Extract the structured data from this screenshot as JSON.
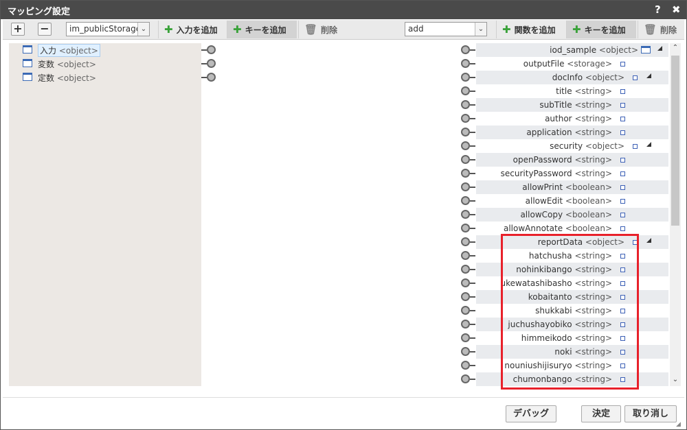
{
  "window": {
    "title": "マッピング設定",
    "help_icon": "?",
    "close_icon": "✖"
  },
  "toolbar": {
    "expand_label": "+",
    "collapse_label": "−",
    "left_select_value": "im_publicStorage",
    "left_add_input": "入力を追加",
    "left_add_key": "キーを追加",
    "left_delete": "削除",
    "right_select_value": "add",
    "right_add_function": "関数を追加",
    "right_add_key": "キーを追加",
    "right_delete": "削除"
  },
  "left_nodes": [
    {
      "name": "入力",
      "type": "<object>"
    },
    {
      "name": "変数",
      "type": "<object>"
    },
    {
      "name": "定数",
      "type": "<object>"
    }
  ],
  "right_nodes": [
    {
      "name": "iod_sample",
      "type": "<object>"
    },
    {
      "name": "outputFile",
      "type": "<storage>"
    },
    {
      "name": "docInfo",
      "type": "<object>"
    },
    {
      "name": "title",
      "type": "<string>"
    },
    {
      "name": "subTitle",
      "type": "<string>"
    },
    {
      "name": "author",
      "type": "<string>"
    },
    {
      "name": "application",
      "type": "<string>"
    },
    {
      "name": "security",
      "type": "<object>"
    },
    {
      "name": "openPassword",
      "type": "<string>"
    },
    {
      "name": "securityPassword",
      "type": "<string>"
    },
    {
      "name": "allowPrint",
      "type": "<boolean>"
    },
    {
      "name": "allowEdit",
      "type": "<boolean>"
    },
    {
      "name": "allowCopy",
      "type": "<boolean>"
    },
    {
      "name": "allowAnnotate",
      "type": "<boolean>"
    },
    {
      "name": "reportData",
      "type": "<object>"
    },
    {
      "name": "hatchusha",
      "type": "<string>"
    },
    {
      "name": "nohinkibango",
      "type": "<string>"
    },
    {
      "name": "ukewatashibasho",
      "type": "<string>"
    },
    {
      "name": "kobaitanto",
      "type": "<string>"
    },
    {
      "name": "shukkabi",
      "type": "<string>"
    },
    {
      "name": "juchushayobiko",
      "type": "<string>"
    },
    {
      "name": "himmeikodo",
      "type": "<string>"
    },
    {
      "name": "noki",
      "type": "<string>"
    },
    {
      "name": "nouniushijisuryo",
      "type": "<string>"
    },
    {
      "name": "chumonbango",
      "type": "<string>"
    }
  ],
  "footer": {
    "debug": "デバッグ",
    "ok": "決定",
    "cancel": "取り消し"
  },
  "colors": {
    "highlight": "#e8202a",
    "accent": "#3b6ab5",
    "add": "#3aa23a"
  }
}
